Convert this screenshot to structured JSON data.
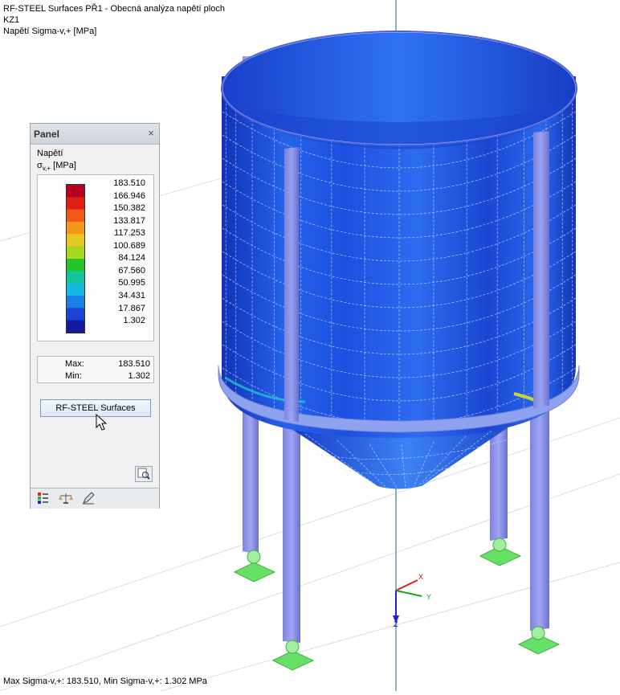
{
  "header": {
    "line1": "RF-STEEL Surfaces PŘ1 - Obecná analýza napětí ploch",
    "line2": "KZ1",
    "line3": "Napětí Sigma-v,+ [MPa]"
  },
  "panel": {
    "title": "Panel",
    "close_symbol": "×",
    "heading": "Napětí",
    "quantity_label": "σ",
    "quantity_sub": "v,+",
    "quantity_unit": " [MPa]",
    "legend_values": [
      "183.510",
      "166.946",
      "150.382",
      "133.817",
      "117.253",
      "100.689",
      "84.124",
      "67.560",
      "50.995",
      "34.431",
      "17.867",
      "1.302"
    ],
    "legend_colors": [
      "#b4001e",
      "#e21f15",
      "#f2581a",
      "#f6951c",
      "#e4c81f",
      "#a6d81e",
      "#25c52a",
      "#14c59b",
      "#14b8e0",
      "#1b7fe8",
      "#1843d6",
      "#111a9c"
    ],
    "max_label": "Max:",
    "max_value": "183.510",
    "min_label": "Min:",
    "min_value": "1.302",
    "button_label": "RF-STEEL Surfaces",
    "tabs": [
      "color-scale-icon",
      "balance-icon",
      "pen-icon"
    ]
  },
  "axes": {
    "x": "X",
    "y": "Y",
    "z": "Z"
  },
  "status": "Max Sigma-v,+: 183.510, Min Sigma-v,+: 1.302 MPa",
  "colors": {
    "shell_blue": "#1d4fe0",
    "column": "#8a8ee6",
    "support": "#66e066",
    "axis_line": "#0e6e7a"
  }
}
